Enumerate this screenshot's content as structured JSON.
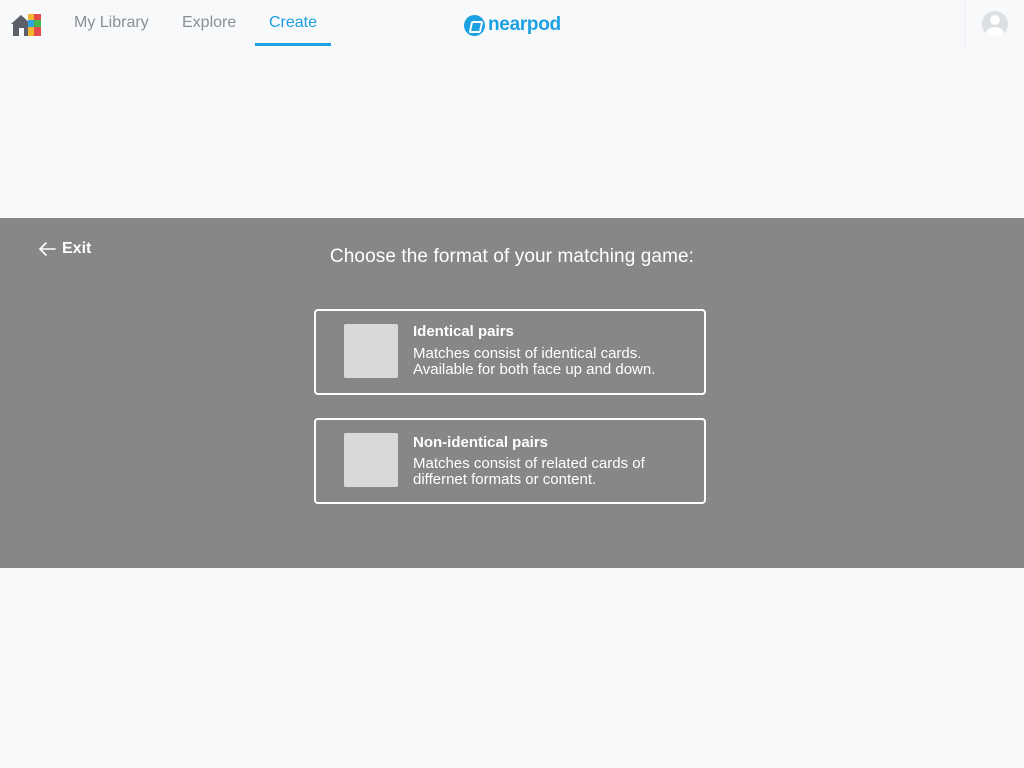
{
  "nav": {
    "tabs": [
      {
        "label": "My Library"
      },
      {
        "label": "Explore"
      },
      {
        "label": "Create"
      }
    ],
    "active_tab": "Create",
    "brand": "nearpod",
    "accent_color": "#1ba0e1",
    "home_icon": "home-icon",
    "avatar_icon": "user-avatar-icon"
  },
  "dialog": {
    "exit_label": "Exit",
    "exit_icon": "arrow-left-icon",
    "heading": "Choose the format of your matching game:",
    "options": [
      {
        "title": "Identical pairs",
        "description": "Matches consist of identical cards. Available for both face up and down."
      },
      {
        "title": "Non-identical pairs",
        "description": "Matches consist of related cards of differnet formats or content."
      }
    ]
  }
}
